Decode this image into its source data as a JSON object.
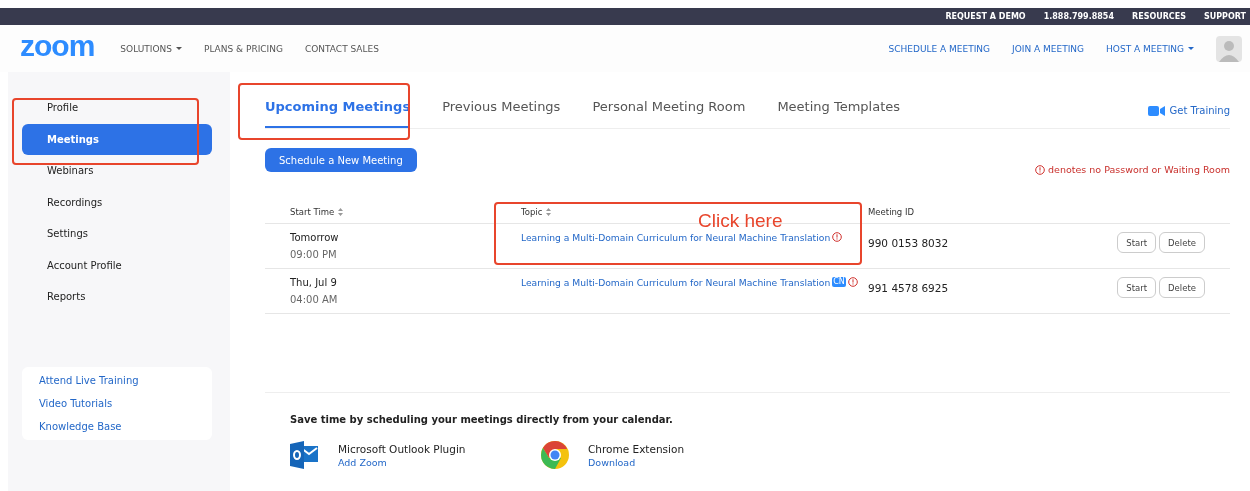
{
  "top_bar": {
    "links": [
      "REQUEST A DEMO",
      "1.888.799.8854",
      "RESOURCES",
      "SUPPORT"
    ]
  },
  "nav": {
    "logo": "zoom",
    "left": [
      {
        "label": "SOLUTIONS",
        "dropdown": true
      },
      {
        "label": "PLANS & PRICING",
        "dropdown": false
      },
      {
        "label": "CONTACT SALES",
        "dropdown": false
      }
    ],
    "right": [
      {
        "label": "SCHEDULE A MEETING",
        "dropdown": false
      },
      {
        "label": "JOIN A MEETING",
        "dropdown": false
      },
      {
        "label": "HOST A MEETING",
        "dropdown": true
      }
    ]
  },
  "sidebar": {
    "items": [
      {
        "label": "Profile",
        "selected": false
      },
      {
        "label": "Meetings",
        "selected": true
      },
      {
        "label": "Webinars",
        "selected": false
      },
      {
        "label": "Recordings",
        "selected": false
      },
      {
        "label": "Settings",
        "selected": false
      },
      {
        "label": "Account Profile",
        "selected": false
      },
      {
        "label": "Reports",
        "selected": false
      }
    ],
    "help_links": [
      "Attend Live Training",
      "Video Tutorials",
      "Knowledge Base"
    ]
  },
  "tabs": [
    {
      "label": "Upcoming Meetings",
      "selected": true
    },
    {
      "label": "Previous Meetings",
      "selected": false
    },
    {
      "label": "Personal Meeting Room",
      "selected": false
    },
    {
      "label": "Meeting Templates",
      "selected": false
    }
  ],
  "get_training": "Get Training",
  "schedule_button": "Schedule a New Meeting",
  "legend": "denotes no Password or Waiting Room",
  "table": {
    "columns": [
      {
        "label": "Start Time",
        "sortable": true
      },
      {
        "label": "Topic",
        "sortable": true
      },
      {
        "label": "Meeting ID",
        "sortable": false
      }
    ],
    "rows": [
      {
        "day": "Tomorrow",
        "time": "09:00 PM",
        "topic": "Learning a Multi-Domain Curriculum for Neural Machine Translation",
        "language_badge": null,
        "no_password": true,
        "meeting_id": "990 0153 8032",
        "actions": [
          "Start",
          "Delete"
        ]
      },
      {
        "day": "Thu, Jul 9",
        "time": "04:00 AM",
        "topic": "Learning a Multi-Domain Curriculum for Neural Machine Translation",
        "language_badge": "CN",
        "no_password": true,
        "meeting_id": "991 4578 6925",
        "actions": [
          "Start",
          "Delete"
        ]
      }
    ]
  },
  "calendar": {
    "heading": "Save time by scheduling your meetings directly from your calendar.",
    "plugins": [
      {
        "kind": "outlook",
        "name": "Microsoft Outlook Plugin",
        "link": "Add Zoom"
      },
      {
        "kind": "chrome",
        "name": "Chrome Extension",
        "link": "Download"
      }
    ]
  },
  "annotation": {
    "label": "Click here"
  }
}
